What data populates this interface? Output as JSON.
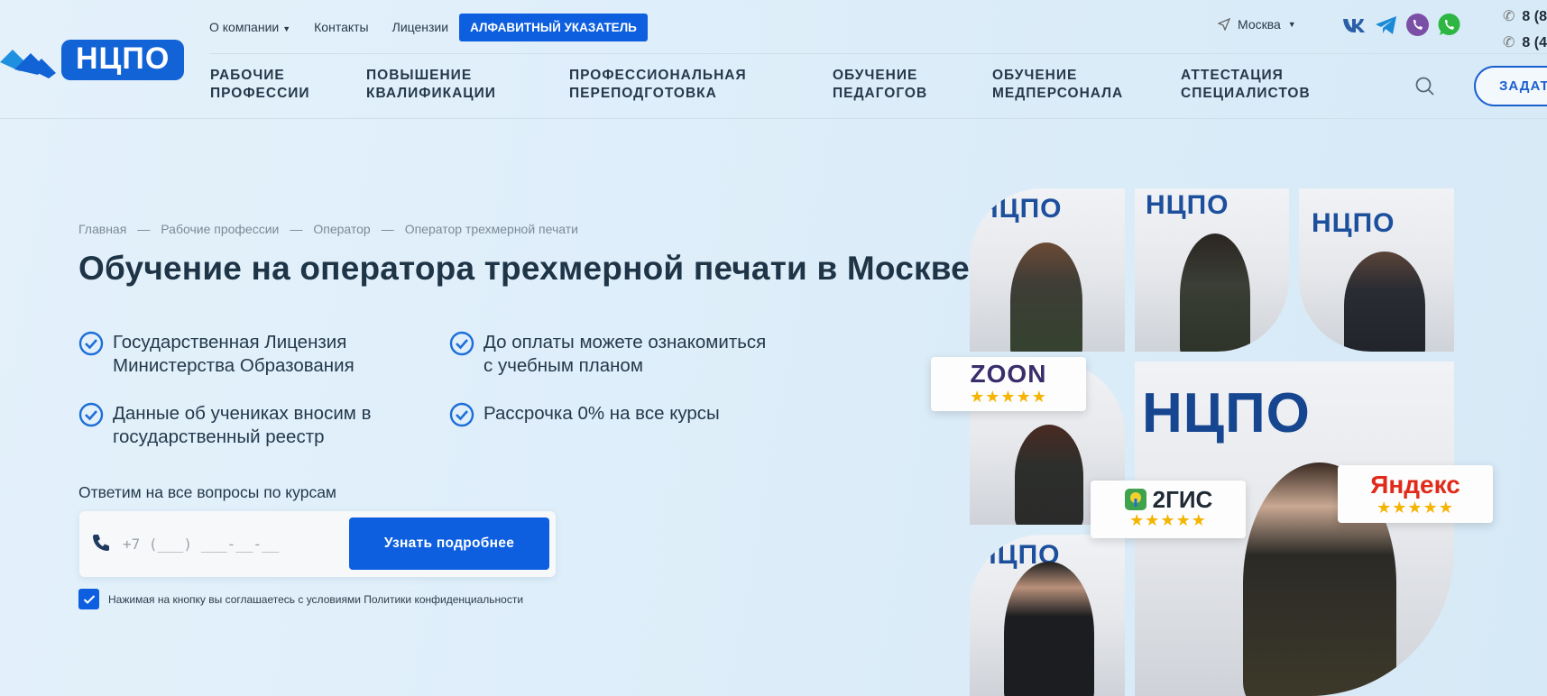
{
  "brand": {
    "logo_text": "НЦПО",
    "accent": "#0d5fe0"
  },
  "topbar": {
    "about": "О компании",
    "contacts": "Контакты",
    "licenses": "Лицензии",
    "alphabet": "АЛФАВИТНЫЙ УКАЗАТЕЛЬ",
    "city": "Москва"
  },
  "phones": [
    "8 (8",
    "8 (4"
  ],
  "nav": [
    "РАБОЧИЕ\nПРОФЕССИИ",
    "ПОВЫШЕНИЕ\nКВАЛИФИКАЦИИ",
    "ПРОФЕССИОНАЛЬНАЯ\nПЕРЕПОДГОТОВКА",
    "ОБУЧЕНИЕ\nПЕДАГОГОВ",
    "ОБУЧЕНИЕ\nМЕДПЕРСОНАЛА",
    "АТТЕСТАЦИЯ\nСПЕЦИАЛИСТОВ"
  ],
  "ask_button": "ЗАДАТ",
  "breadcrumbs": [
    "Главная",
    "Рабочие профессии",
    "Оператор",
    "Оператор трехмерной печати"
  ],
  "breadcrumb_sep": "—",
  "title": "Обучение на оператора трехмерной печати в Москве",
  "features": [
    "Государственная Лицензия\nМинистерства Образования",
    "До оплаты можете ознакомиться\nс учебным планом",
    "Данные об учениках вносим в\nгосударственный реестр",
    "Рассрочка 0% на все курсы"
  ],
  "form": {
    "label": "Ответим на все вопросы по курсам",
    "phone_placeholder": "+7 (___) ___-__-__",
    "submit": "Узнать подробнее",
    "consent": "Нажимая на кнопку вы соглашаетесь с условиями Политики конфиденциальности"
  },
  "badges": {
    "zoon": "ZOON",
    "gis": "2ГИС",
    "yandex": "Яндекс",
    "stars": "★★★★★"
  }
}
